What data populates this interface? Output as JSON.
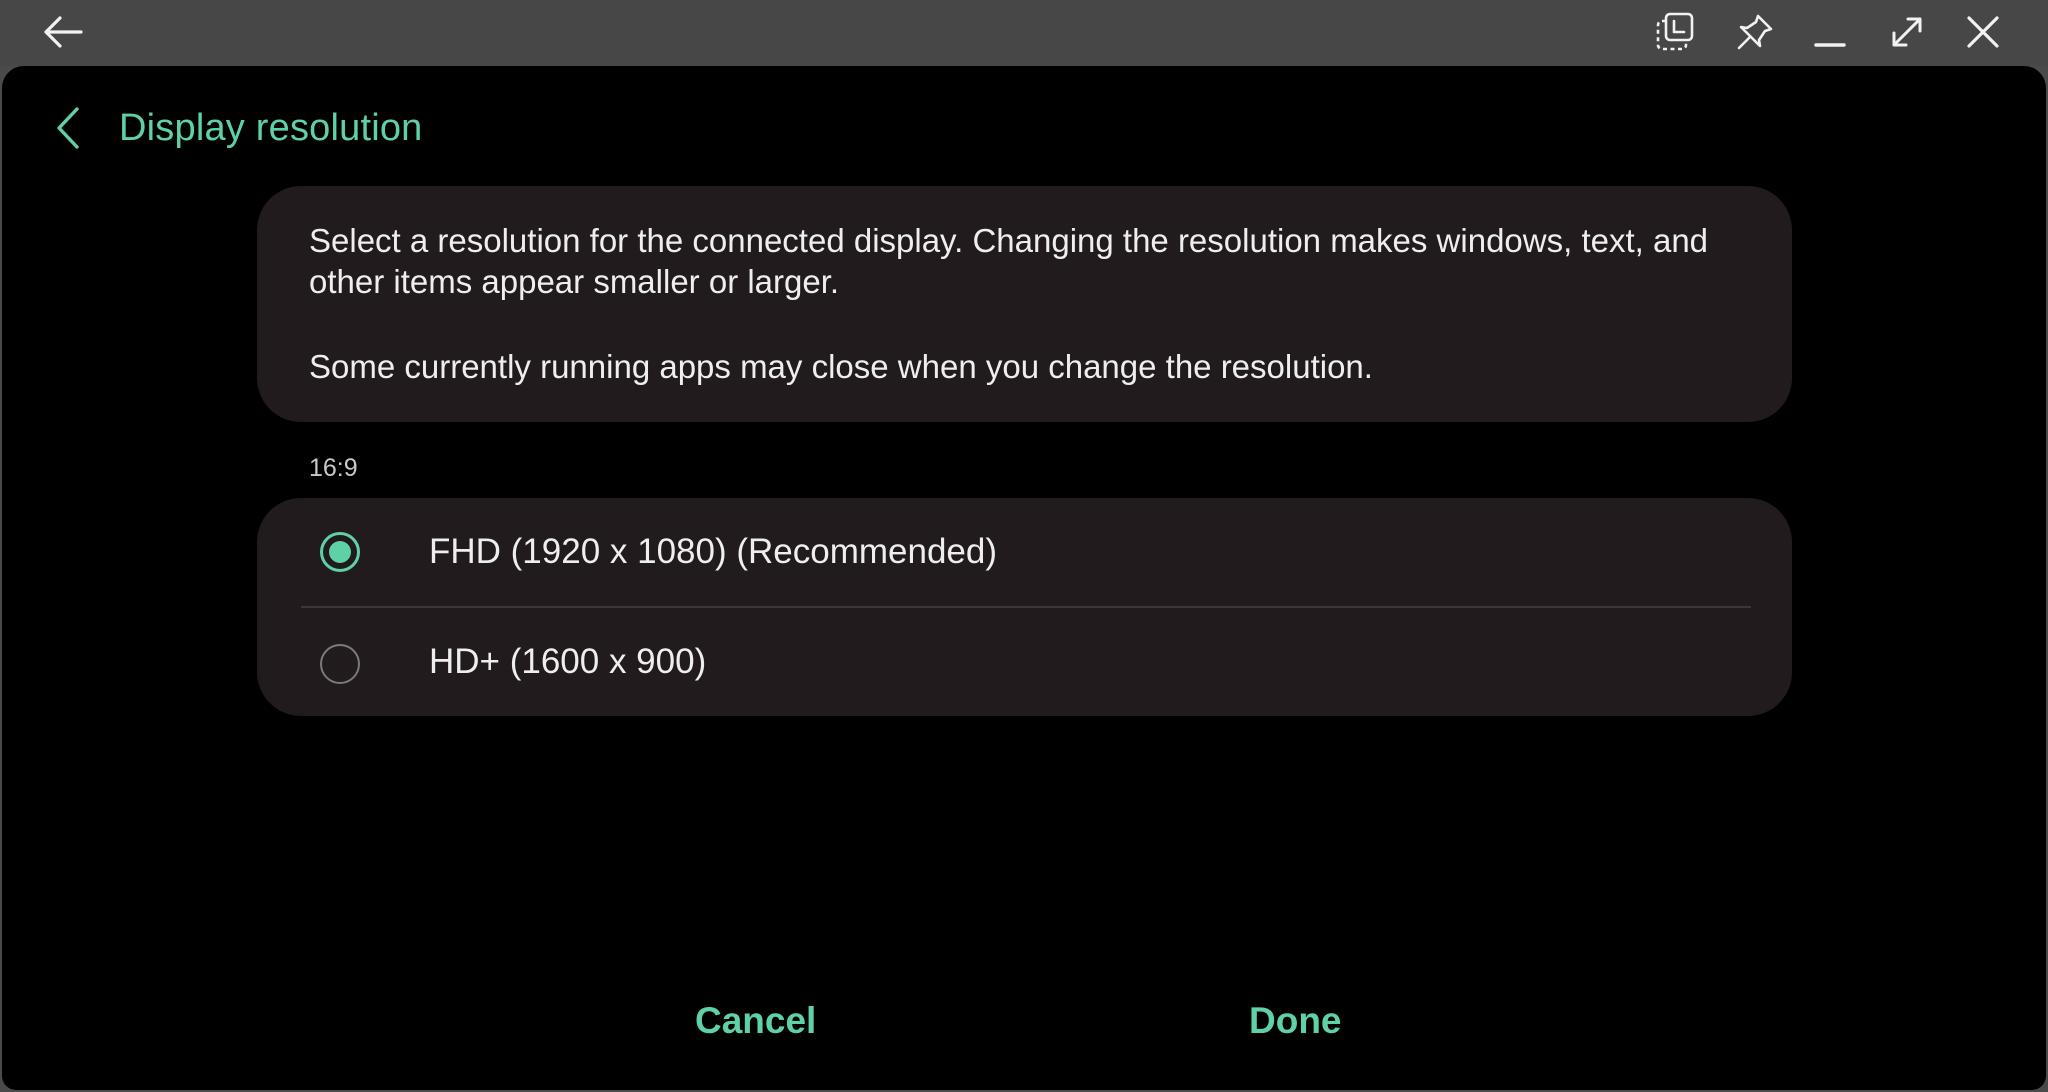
{
  "titlebar": {
    "icons": [
      "back-arrow-icon",
      "screenshot-select-icon",
      "pin-icon",
      "minimize-icon",
      "maximize-icon",
      "close-icon"
    ]
  },
  "header": {
    "title": "Display resolution"
  },
  "info": {
    "paragraph1": "Select a resolution for the connected display. Changing the resolution makes windows, text, and other items appear smaller or larger.",
    "paragraph2": "Some currently running apps may close when you change the resolution."
  },
  "aspect_label": "16:9",
  "options": [
    {
      "label": "FHD (1920 x 1080) (Recommended)",
      "selected": true
    },
    {
      "label": "HD+ (1600 x 900)",
      "selected": false
    }
  ],
  "buttons": {
    "cancel": "Cancel",
    "done": "Done"
  },
  "colors": {
    "accent": "#5fd1a6",
    "card": "#221b1d",
    "background": "#000000",
    "titlebar": "#474747"
  }
}
